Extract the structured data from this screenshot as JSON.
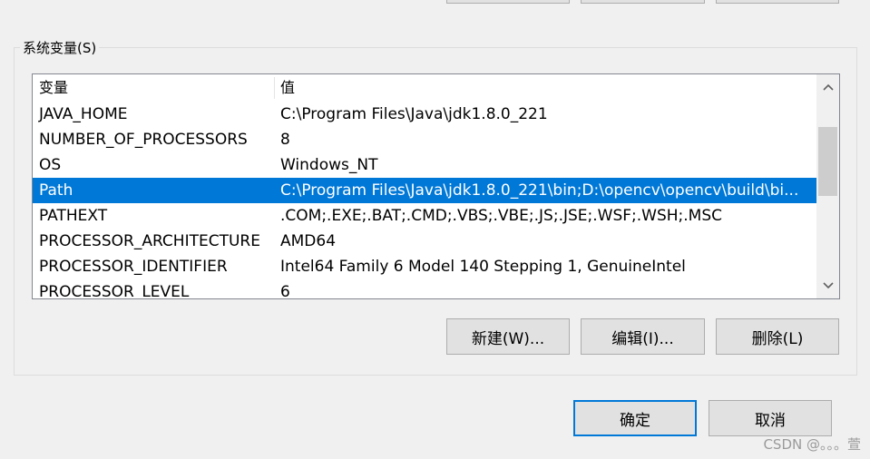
{
  "group": {
    "title": "系统变量(S)"
  },
  "list": {
    "headers": {
      "name": "变量",
      "value": "值"
    },
    "rows": [
      {
        "name": "JAVA_HOME",
        "value": "C:\\Program Files\\Java\\jdk1.8.0_221"
      },
      {
        "name": "NUMBER_OF_PROCESSORS",
        "value": "8"
      },
      {
        "name": "OS",
        "value": "Windows_NT"
      },
      {
        "name": "Path",
        "value": "C:\\Program Files\\Java\\jdk1.8.0_221\\bin;D:\\opencv\\opencv\\build\\bi..."
      },
      {
        "name": "PATHEXT",
        "value": ".COM;.EXE;.BAT;.CMD;.VBS;.VBE;.JS;.JSE;.WSF;.WSH;.MSC"
      },
      {
        "name": "PROCESSOR_ARCHITECTURE",
        "value": "AMD64"
      },
      {
        "name": "PROCESSOR_IDENTIFIER",
        "value": "Intel64 Family 6 Model 140 Stepping 1, GenuineIntel"
      },
      {
        "name": "PROCESSOR_LEVEL",
        "value": "6"
      }
    ],
    "selected_row": "Path"
  },
  "buttons": {
    "new": "新建(W)...",
    "edit": "编辑(I)...",
    "delete": "删除(L)",
    "ok": "确定",
    "cancel": "取消"
  },
  "icons": {
    "scroll_up": "chevron-up-icon",
    "scroll_down": "chevron-down-icon"
  },
  "colors": {
    "selection": "#0078d7",
    "default_button_border": "#0078d7"
  },
  "watermark": "CSDN @。。。萱"
}
